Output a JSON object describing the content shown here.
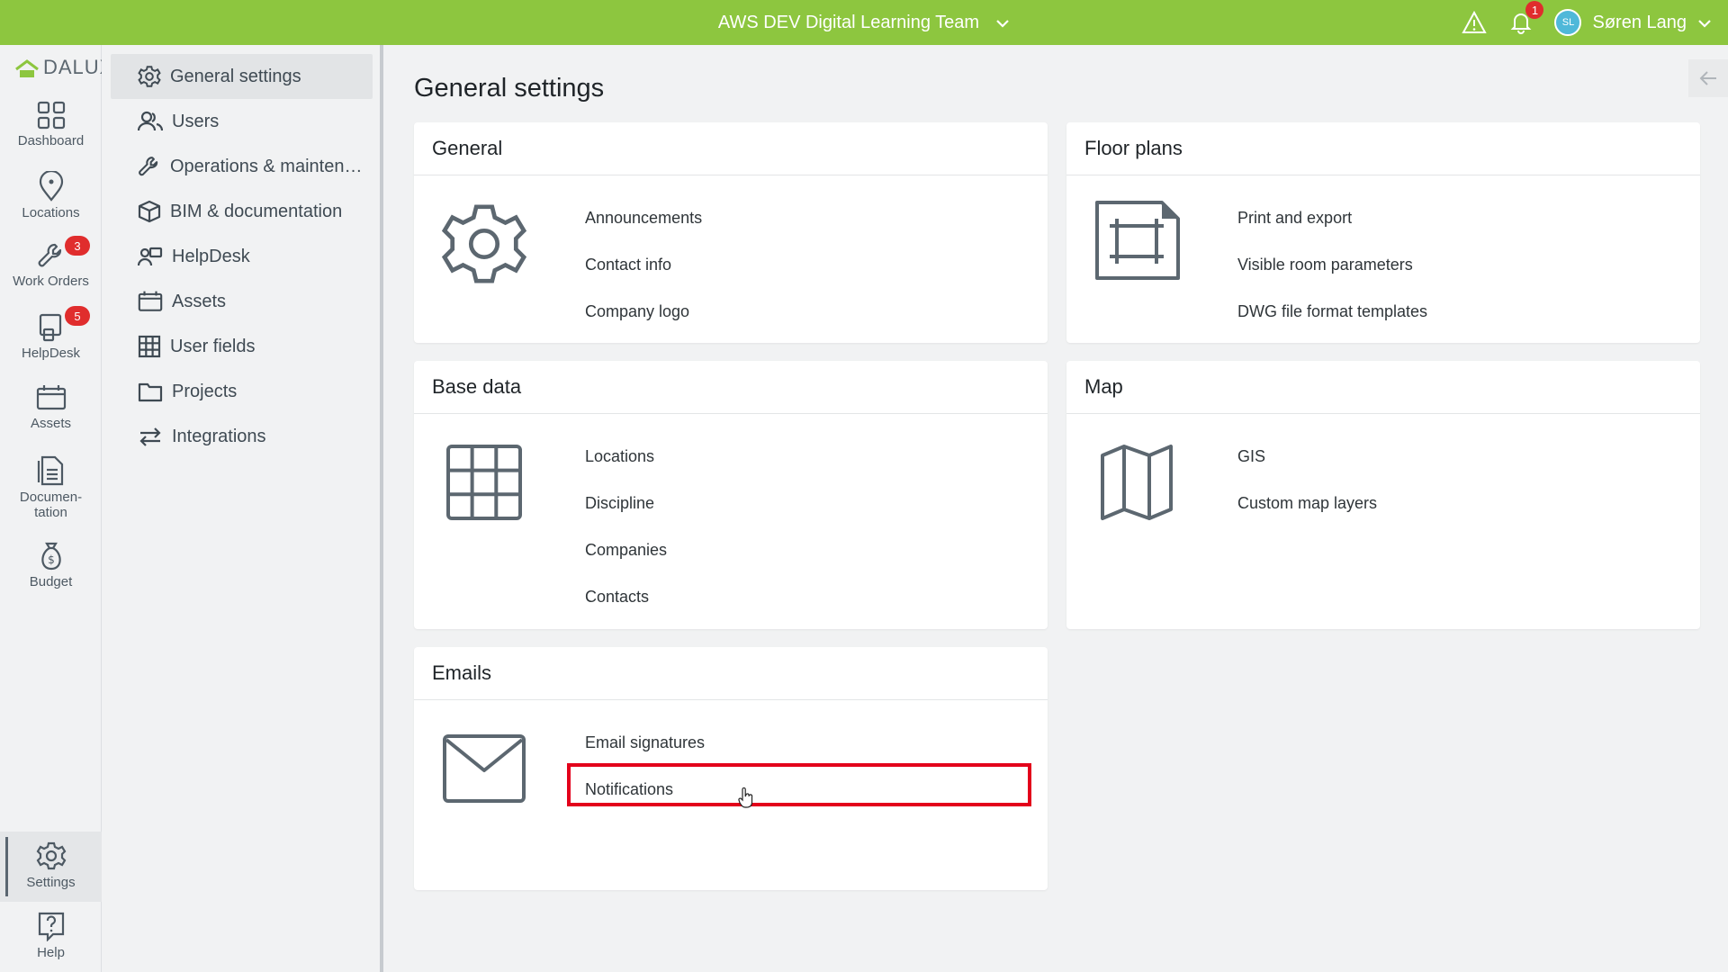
{
  "topbar": {
    "team_name": "AWS DEV Digital Learning Team",
    "notification_count": "1",
    "user_initials": "SL",
    "user_name": "Søren Lang"
  },
  "rail": {
    "logo": "DALUX",
    "items": [
      {
        "label": "Dashboard",
        "icon": "dashboard-icon"
      },
      {
        "label": "Locations",
        "icon": "location-pin-icon"
      },
      {
        "label": "Work Orders",
        "icon": "wrench-icon",
        "badge": "3"
      },
      {
        "label": "HelpDesk",
        "icon": "helpdesk-icon",
        "badge": "5"
      },
      {
        "label": "Assets",
        "icon": "assets-icon"
      },
      {
        "label": "Documen-\ntation",
        "icon": "document-icon"
      },
      {
        "label": "Budget",
        "icon": "budget-icon"
      },
      {
        "label": "Settings",
        "icon": "gear-icon"
      },
      {
        "label": "Help",
        "icon": "help-icon"
      }
    ]
  },
  "sidebar": {
    "items": [
      {
        "label": "General settings",
        "icon": "gear-icon"
      },
      {
        "label": "Users",
        "icon": "users-icon"
      },
      {
        "label": "Operations & mainten…",
        "icon": "wrench-icon"
      },
      {
        "label": "BIM & documentation",
        "icon": "cube-icon"
      },
      {
        "label": "HelpDesk",
        "icon": "helpdesk-icon"
      },
      {
        "label": "Assets",
        "icon": "assets-icon"
      },
      {
        "label": "User fields",
        "icon": "grid-icon"
      },
      {
        "label": "Projects",
        "icon": "folder-icon"
      },
      {
        "label": "Integrations",
        "icon": "arrows-icon"
      }
    ]
  },
  "main": {
    "title": "General settings",
    "cards": {
      "general": {
        "title": "General",
        "links": [
          "Announcements",
          "Contact info",
          "Company logo"
        ]
      },
      "floor_plans": {
        "title": "Floor plans",
        "links": [
          "Print and export",
          "Visible room parameters",
          "DWG file format templates"
        ]
      },
      "base_data": {
        "title": "Base data",
        "links": [
          "Locations",
          "Discipline",
          "Companies",
          "Contacts"
        ]
      },
      "map": {
        "title": "Map",
        "links": [
          "GIS",
          "Custom map layers"
        ]
      },
      "emails": {
        "title": "Emails",
        "links": [
          "Email signatures",
          "Notifications"
        ]
      }
    }
  },
  "colors": {
    "topbar": "#8dc63f",
    "badge": "#e02d2d",
    "highlight": "#e3001b"
  }
}
